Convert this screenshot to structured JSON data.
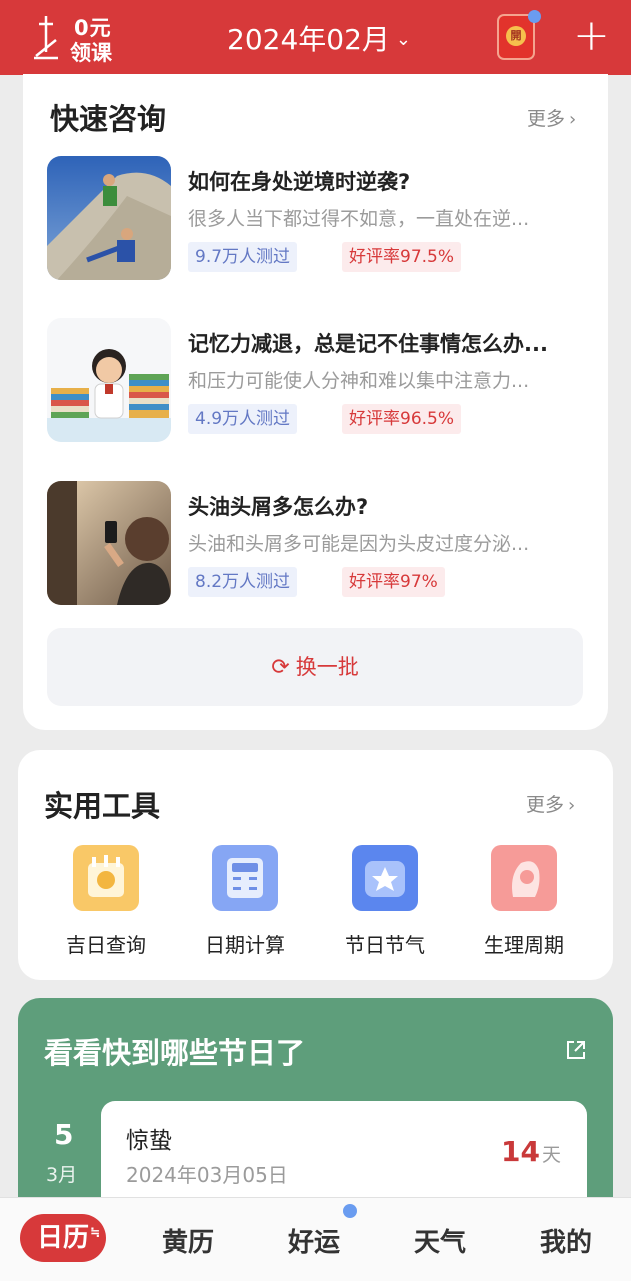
{
  "header": {
    "lesson_line1": "0元",
    "lesson_line2": "领课",
    "month": "2024年02月",
    "redpack_char": "開"
  },
  "quick_consult": {
    "title": "快速咨询",
    "more": "更多",
    "items": [
      {
        "title": "如何在身处逆境时逆袭?",
        "desc": "很多人当下都过得不如意，一直处在逆...",
        "tested": "9.7万人测过",
        "rating": "好评率97.5%"
      },
      {
        "title": "记忆力减退，总是记不住事情怎么办...",
        "desc": "和压力可能使人分神和难以集中注意力...",
        "tested": "4.9万人测过",
        "rating": "好评率96.5%"
      },
      {
        "title": "头油头屑多怎么办?",
        "desc": "头油和头屑多可能是因为头皮过度分泌...",
        "tested": "8.2万人测过",
        "rating": "好评率97%"
      }
    ],
    "refresh": "换一批"
  },
  "tools": {
    "title": "实用工具",
    "more": "更多",
    "items": [
      {
        "label": "吉日查询",
        "icon": "calendar-seal-icon",
        "color": "#f7c35c"
      },
      {
        "label": "日期计算",
        "icon": "calculator-icon",
        "color": "#7f9ff2"
      },
      {
        "label": "节日节气",
        "icon": "festival-star-icon",
        "color": "#5b86ee"
      },
      {
        "label": "生理周期",
        "icon": "woman-profile-icon",
        "color": "#f58e8e"
      }
    ]
  },
  "festivals": {
    "title": "看看快到哪些节日了",
    "day": "5",
    "month": "3月",
    "name": "惊蛰",
    "date": "2024年03月05日",
    "count": "14",
    "unit": "天"
  },
  "tabbar": {
    "tabs": [
      "日历",
      "黄历",
      "好运",
      "天气",
      "我的"
    ],
    "active_badge": "≒"
  },
  "colors": {
    "brand_red": "#d7393a",
    "green_card": "#5e9e7b"
  }
}
